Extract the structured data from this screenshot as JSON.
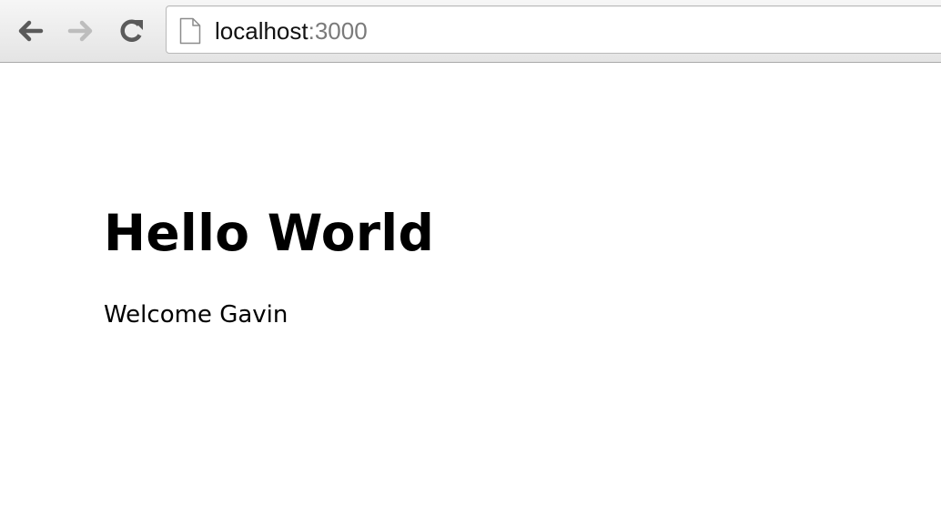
{
  "browser": {
    "back_icon": "arrow-left-icon",
    "forward_icon": "arrow-right-icon",
    "reload_icon": "reload-icon",
    "page_icon": "document-icon",
    "url": {
      "host": "localhost",
      "port": ":3000"
    },
    "forward_enabled": false
  },
  "page": {
    "heading": "Hello World",
    "welcome": "Welcome Gavin"
  },
  "colors": {
    "toolbar": "#e9e9e9",
    "icon_active": "#5a5a5a",
    "icon_disabled": "#bdbdbd",
    "url_port": "#7a7a7a"
  }
}
